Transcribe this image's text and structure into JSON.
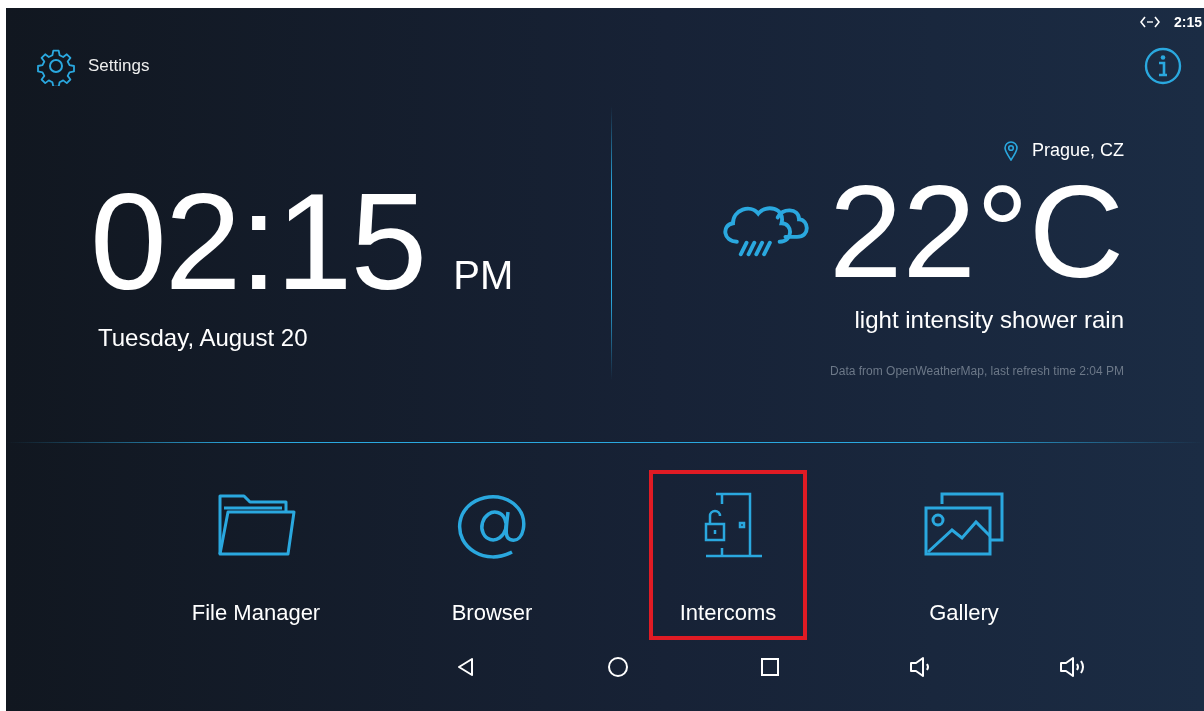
{
  "status_bar": {
    "time": "2:15"
  },
  "header": {
    "settings_label": "Settings"
  },
  "clock": {
    "time": "02:15",
    "meridiem": "PM",
    "date": "Tuesday, August 20"
  },
  "weather": {
    "location": "Prague, CZ",
    "temperature": "22°C",
    "description": "light intensity shower rain",
    "source": "Data from OpenWeatherMap, last refresh time 2:04 PM"
  },
  "apps": [
    {
      "kind": "folder",
      "label": "File Manager",
      "highlighted": false
    },
    {
      "kind": "at",
      "label": "Browser",
      "highlighted": false
    },
    {
      "kind": "door",
      "label": "Intercoms",
      "highlighted": true
    },
    {
      "kind": "gallery",
      "label": "Gallery",
      "highlighted": false
    }
  ],
  "nav_bar": [
    {
      "kind": "back"
    },
    {
      "kind": "home"
    },
    {
      "kind": "recents"
    },
    {
      "kind": "volume-down"
    },
    {
      "kind": "volume-up"
    }
  ]
}
